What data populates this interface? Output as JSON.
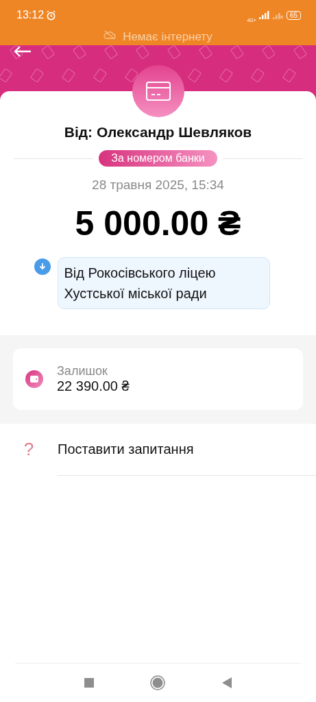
{
  "status_bar": {
    "time": "13:12",
    "network": "4G+",
    "battery": "65"
  },
  "offline_banner": {
    "text": "Немає інтернету"
  },
  "transfer": {
    "sender": "Від: Олександр Шевляков",
    "method": "За номером банки",
    "date": "28 травня 2025, 15:34",
    "amount": "5 000.00 ₴",
    "comment": "Від Рокосівського ліцею Хустської міської ради"
  },
  "balance": {
    "label": "Залишок",
    "value": "22 390.00 ₴"
  },
  "actions": [
    {
      "icon": "?",
      "label": "Поставити запитання"
    }
  ]
}
